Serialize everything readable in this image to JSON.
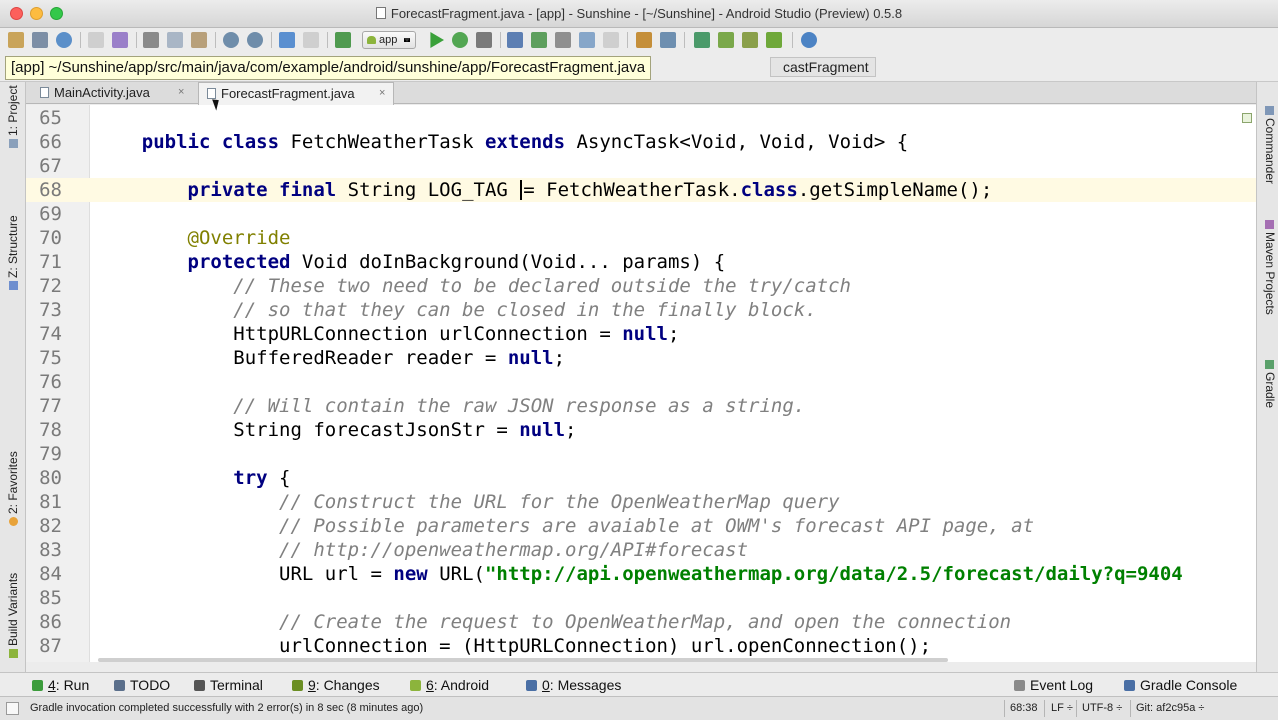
{
  "window": {
    "title": "ForecastFragment.java - [app] - Sunshine - [~/Sunshine] - Android Studio (Preview) 0.5.8"
  },
  "toolbar": {
    "run_config": "app"
  },
  "navbar": {
    "path_tooltip": "[app] ~/Sunshine/app/src/main/java/com/example/android/sunshine/app/ForecastFragment.java",
    "crumb_tail": "castFragment"
  },
  "tabs": [
    {
      "label": "MainActivity.java",
      "close": "×",
      "active": false
    },
    {
      "label": "ForecastFragment.java",
      "close": "×",
      "active": true
    }
  ],
  "left_panels": {
    "project": "1: Project",
    "structure": "Z: Structure",
    "favorites": "2: Favorites",
    "build_variants": "Build Variants"
  },
  "right_panels": {
    "commander": "Commander",
    "maven": "Maven Projects",
    "gradle": "Gradle"
  },
  "editor": {
    "lines": [
      {
        "n": "65",
        "caret_row": false,
        "segs": []
      },
      {
        "n": "66",
        "caret_row": false,
        "segs": [
          {
            "t": "    "
          },
          {
            "t": "public class",
            "c": "kw"
          },
          {
            "t": " FetchWeatherTask "
          },
          {
            "t": "extends",
            "c": "kw"
          },
          {
            "t": " AsyncTask<Void, Void, Void> {"
          }
        ]
      },
      {
        "n": "67",
        "caret_row": false,
        "segs": []
      },
      {
        "n": "68",
        "caret_row": true,
        "segs": [
          {
            "t": "        "
          },
          {
            "t": "private final",
            "c": "kw"
          },
          {
            "t": " String LOG_TAG "
          },
          {
            "t": "",
            "c": "caret"
          },
          {
            "t": "= FetchWeatherTask."
          },
          {
            "t": "class",
            "c": "kw"
          },
          {
            "t": ".getSimpleName();"
          }
        ]
      },
      {
        "n": "69",
        "caret_row": false,
        "segs": []
      },
      {
        "n": "70",
        "caret_row": false,
        "segs": [
          {
            "t": "        "
          },
          {
            "t": "@Override",
            "c": "an"
          }
        ]
      },
      {
        "n": "71",
        "caret_row": false,
        "segs": [
          {
            "t": "        "
          },
          {
            "t": "protected",
            "c": "kw"
          },
          {
            "t": " Void doInBackground(Void... params) {"
          }
        ]
      },
      {
        "n": "72",
        "caret_row": false,
        "segs": [
          {
            "t": "            "
          },
          {
            "t": "// These two need to be declared outside the try/catch",
            "c": "cm"
          }
        ]
      },
      {
        "n": "73",
        "caret_row": false,
        "segs": [
          {
            "t": "            "
          },
          {
            "t": "// so that they can be closed in the finally block.",
            "c": "cm"
          }
        ]
      },
      {
        "n": "74",
        "caret_row": false,
        "segs": [
          {
            "t": "            HttpURLConnection urlConnection = "
          },
          {
            "t": "null",
            "c": "kw"
          },
          {
            "t": ";"
          }
        ]
      },
      {
        "n": "75",
        "caret_row": false,
        "segs": [
          {
            "t": "            BufferedReader reader = "
          },
          {
            "t": "null",
            "c": "kw"
          },
          {
            "t": ";"
          }
        ]
      },
      {
        "n": "76",
        "caret_row": false,
        "segs": []
      },
      {
        "n": "77",
        "caret_row": false,
        "segs": [
          {
            "t": "            "
          },
          {
            "t": "// Will contain the raw JSON response as a string.",
            "c": "cm"
          }
        ]
      },
      {
        "n": "78",
        "caret_row": false,
        "segs": [
          {
            "t": "            String forecastJsonStr = "
          },
          {
            "t": "null",
            "c": "kw"
          },
          {
            "t": ";"
          }
        ]
      },
      {
        "n": "79",
        "caret_row": false,
        "segs": []
      },
      {
        "n": "80",
        "caret_row": false,
        "segs": [
          {
            "t": "            "
          },
          {
            "t": "try",
            "c": "kw"
          },
          {
            "t": " {"
          }
        ]
      },
      {
        "n": "81",
        "caret_row": false,
        "segs": [
          {
            "t": "                "
          },
          {
            "t": "// Construct the URL for the OpenWeatherMap query",
            "c": "cm"
          }
        ]
      },
      {
        "n": "82",
        "caret_row": false,
        "segs": [
          {
            "t": "                "
          },
          {
            "t": "// Possible parameters are avaiable at OWM's forecast API page, at",
            "c": "cm"
          }
        ]
      },
      {
        "n": "83",
        "caret_row": false,
        "segs": [
          {
            "t": "                "
          },
          {
            "t": "// http://openweathermap.org/API#forecast",
            "c": "cm"
          }
        ]
      },
      {
        "n": "84",
        "caret_row": false,
        "segs": [
          {
            "t": "                URL url = "
          },
          {
            "t": "new",
            "c": "kw"
          },
          {
            "t": " URL("
          },
          {
            "t": "\"http://api.openweathermap.org/data/2.5/forecast/daily?q=9404",
            "c": "st"
          }
        ]
      },
      {
        "n": "85",
        "caret_row": false,
        "segs": []
      },
      {
        "n": "86",
        "caret_row": false,
        "segs": [
          {
            "t": "                "
          },
          {
            "t": "// Create the request to OpenWeatherMap, and open the connection",
            "c": "cm"
          }
        ]
      },
      {
        "n": "87",
        "caret_row": false,
        "segs": [
          {
            "t": "                urlConnection = (HttpURLConnection) url.openConnection();"
          }
        ]
      }
    ]
  },
  "bottom_tools": [
    {
      "key": "4",
      "label": ": Run",
      "color": "#3c9c3c"
    },
    {
      "key": "",
      "label": "TODO",
      "color": "#5b6f8b"
    },
    {
      "key": "",
      "label": "Terminal",
      "color": "#555555"
    },
    {
      "key": "9",
      "label": ": Changes",
      "color": "#6b8e23"
    },
    {
      "key": "6",
      "label": ": Android",
      "color": "#8cb43c"
    },
    {
      "key": "0",
      "label": ": Messages",
      "color": "#4a6fa5"
    },
    {
      "key": "",
      "label": "Event Log",
      "color": "#8a8a8a"
    },
    {
      "key": "",
      "label": "Gradle Console",
      "color": "#4a6fa5"
    }
  ],
  "status": {
    "message": "Gradle invocation completed successfully with 2 error(s) in 8 sec (8 minutes ago)",
    "position": "68:38",
    "line_sep": "LF ÷",
    "encoding": "UTF-8 ÷",
    "vcs": "Git: af2c95a ÷"
  }
}
